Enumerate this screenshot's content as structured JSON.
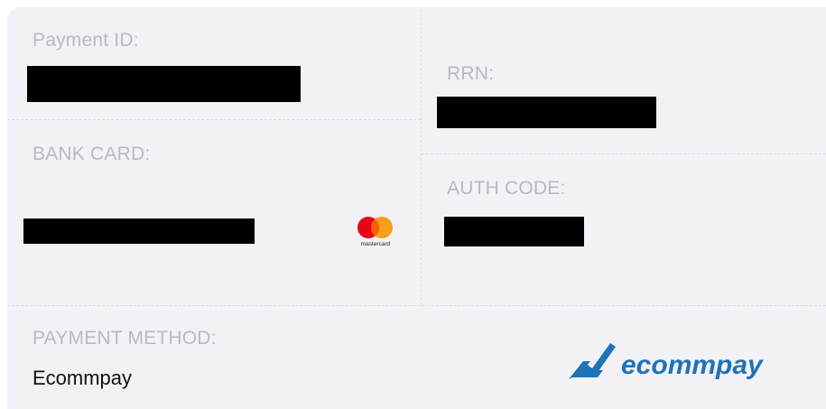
{
  "fields": {
    "payment_id_label": "Payment ID:",
    "rrn_label": "RRN:",
    "bank_card_label": "BANK CARD:",
    "auth_code_label": "AUTH CODE:",
    "payment_method_label": "PAYMENT METHOD:",
    "payment_method_value": "Ecommpay"
  },
  "card_brand": {
    "icon": "mastercard-logo",
    "caption": "mastercard",
    "colors": {
      "red": "#eb001b",
      "orange": "#f79e1b",
      "overlap": "#ff5f00"
    }
  },
  "provider_logo": {
    "icon": "ecommpay-logo",
    "text": "ecommpay",
    "color": "#1f73b7"
  },
  "redacted_values": {
    "payment_id": "redacted",
    "rrn": "redacted",
    "bank_card_number": "redacted",
    "auth_code": "redacted"
  }
}
